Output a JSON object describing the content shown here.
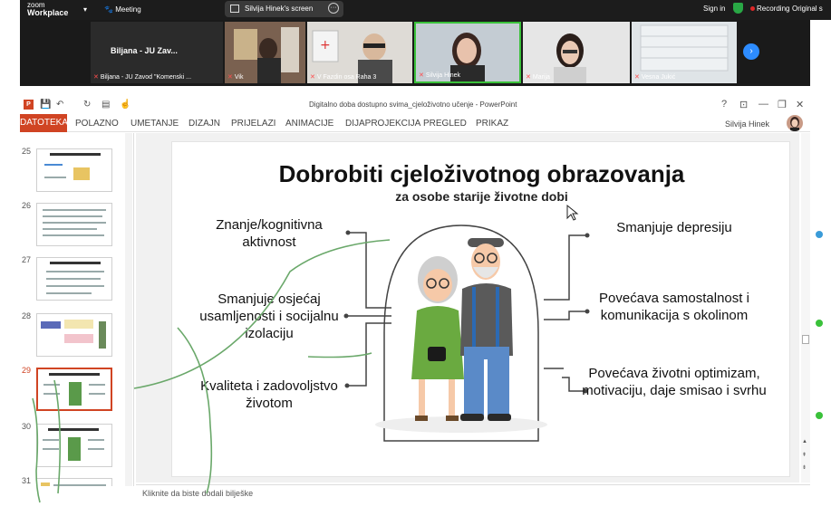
{
  "zoom": {
    "brand_line1": "zoom",
    "brand_line2": "Workplace",
    "meeting_label": "Meeting",
    "share_label": "Silvija Hinek's screen",
    "sign_in": "Sign in",
    "recording": "Recording",
    "original": "Original s"
  },
  "participants": [
    {
      "name": "Biljana - JU Zavod \"Komenski ...",
      "big_label": "Biljana - JU Zav..."
    },
    {
      "name": "Vik"
    },
    {
      "name": "V Fazdin osa Raha 3"
    },
    {
      "name": "Silvija Hinek"
    },
    {
      "name": "Marija"
    },
    {
      "name": "Vesna Jukić"
    }
  ],
  "ppt": {
    "doc_title": "Digitalno doba dostupno svima_cjeloživotno učenje - PowerPoint",
    "tabs": [
      "DATOTEKA",
      "POLAZNO",
      "UMETANJE",
      "DIZAJN",
      "PRIJELAZI",
      "ANIMACIJE",
      "DIJAPROJEKCIJA",
      "PREGLED",
      "PRIKAZ"
    ],
    "user": "Silvija Hinek",
    "notes_placeholder": "Kliknite da biste dodali bilješke",
    "thumb_numbers": [
      "25",
      "26",
      "27",
      "28",
      "29",
      "30",
      "31"
    ],
    "active_slide": "29"
  },
  "slide": {
    "title": "Dobrobiti cjeloživotnog obrazovanja",
    "subtitle": "za osobe starije životne dobi",
    "left": [
      "Znanje/kognitivna aktivnost",
      "Smanjuje osjećaj usamljenosti i socijalnu izolaciju",
      "Kvaliteta i zadovoljstvo životom"
    ],
    "right": [
      "Smanjuje depresiju",
      "Povećava samostalnost i komunikacija s okolinom",
      "Povećava životni optimizam, motivaciju, daje smisao i svrhu"
    ]
  },
  "colors": {
    "ppt_accent": "#d04423",
    "zoom_blue": "#2d8cff",
    "pen_green": "#6aa86a"
  }
}
